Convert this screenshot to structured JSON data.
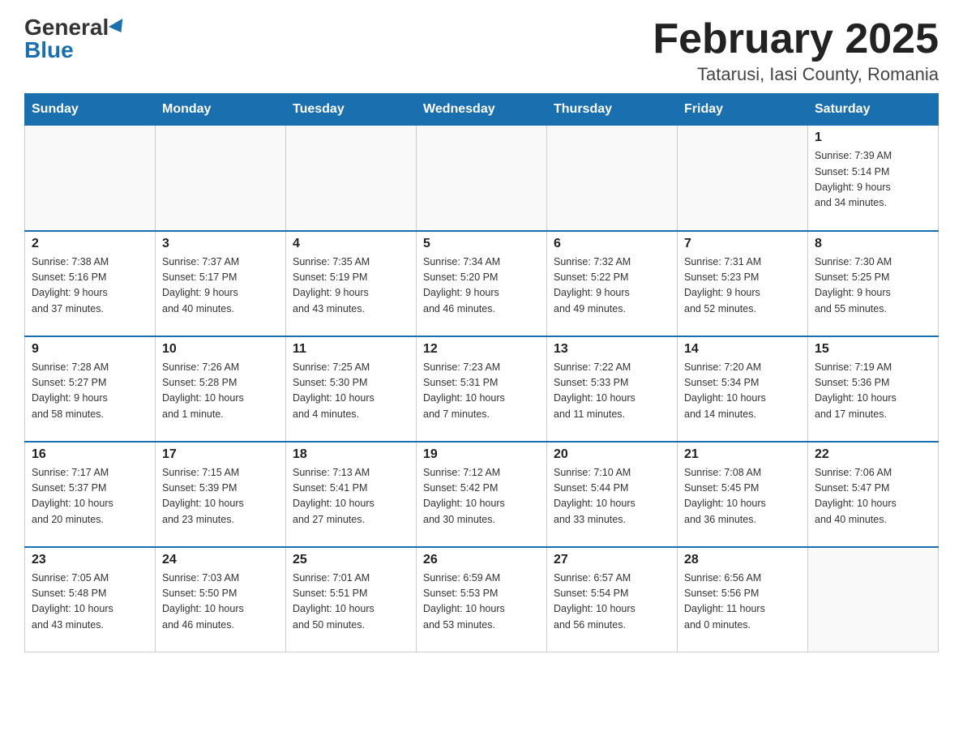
{
  "header": {
    "logo_general": "General",
    "logo_blue": "Blue",
    "month_title": "February 2025",
    "location": "Tatarusi, Iasi County, Romania"
  },
  "weekdays": [
    "Sunday",
    "Monday",
    "Tuesday",
    "Wednesday",
    "Thursday",
    "Friday",
    "Saturday"
  ],
  "weeks": [
    [
      {
        "day": "",
        "info": ""
      },
      {
        "day": "",
        "info": ""
      },
      {
        "day": "",
        "info": ""
      },
      {
        "day": "",
        "info": ""
      },
      {
        "day": "",
        "info": ""
      },
      {
        "day": "",
        "info": ""
      },
      {
        "day": "1",
        "info": "Sunrise: 7:39 AM\nSunset: 5:14 PM\nDaylight: 9 hours\nand 34 minutes."
      }
    ],
    [
      {
        "day": "2",
        "info": "Sunrise: 7:38 AM\nSunset: 5:16 PM\nDaylight: 9 hours\nand 37 minutes."
      },
      {
        "day": "3",
        "info": "Sunrise: 7:37 AM\nSunset: 5:17 PM\nDaylight: 9 hours\nand 40 minutes."
      },
      {
        "day": "4",
        "info": "Sunrise: 7:35 AM\nSunset: 5:19 PM\nDaylight: 9 hours\nand 43 minutes."
      },
      {
        "day": "5",
        "info": "Sunrise: 7:34 AM\nSunset: 5:20 PM\nDaylight: 9 hours\nand 46 minutes."
      },
      {
        "day": "6",
        "info": "Sunrise: 7:32 AM\nSunset: 5:22 PM\nDaylight: 9 hours\nand 49 minutes."
      },
      {
        "day": "7",
        "info": "Sunrise: 7:31 AM\nSunset: 5:23 PM\nDaylight: 9 hours\nand 52 minutes."
      },
      {
        "day": "8",
        "info": "Sunrise: 7:30 AM\nSunset: 5:25 PM\nDaylight: 9 hours\nand 55 minutes."
      }
    ],
    [
      {
        "day": "9",
        "info": "Sunrise: 7:28 AM\nSunset: 5:27 PM\nDaylight: 9 hours\nand 58 minutes."
      },
      {
        "day": "10",
        "info": "Sunrise: 7:26 AM\nSunset: 5:28 PM\nDaylight: 10 hours\nand 1 minute."
      },
      {
        "day": "11",
        "info": "Sunrise: 7:25 AM\nSunset: 5:30 PM\nDaylight: 10 hours\nand 4 minutes."
      },
      {
        "day": "12",
        "info": "Sunrise: 7:23 AM\nSunset: 5:31 PM\nDaylight: 10 hours\nand 7 minutes."
      },
      {
        "day": "13",
        "info": "Sunrise: 7:22 AM\nSunset: 5:33 PM\nDaylight: 10 hours\nand 11 minutes."
      },
      {
        "day": "14",
        "info": "Sunrise: 7:20 AM\nSunset: 5:34 PM\nDaylight: 10 hours\nand 14 minutes."
      },
      {
        "day": "15",
        "info": "Sunrise: 7:19 AM\nSunset: 5:36 PM\nDaylight: 10 hours\nand 17 minutes."
      }
    ],
    [
      {
        "day": "16",
        "info": "Sunrise: 7:17 AM\nSunset: 5:37 PM\nDaylight: 10 hours\nand 20 minutes."
      },
      {
        "day": "17",
        "info": "Sunrise: 7:15 AM\nSunset: 5:39 PM\nDaylight: 10 hours\nand 23 minutes."
      },
      {
        "day": "18",
        "info": "Sunrise: 7:13 AM\nSunset: 5:41 PM\nDaylight: 10 hours\nand 27 minutes."
      },
      {
        "day": "19",
        "info": "Sunrise: 7:12 AM\nSunset: 5:42 PM\nDaylight: 10 hours\nand 30 minutes."
      },
      {
        "day": "20",
        "info": "Sunrise: 7:10 AM\nSunset: 5:44 PM\nDaylight: 10 hours\nand 33 minutes."
      },
      {
        "day": "21",
        "info": "Sunrise: 7:08 AM\nSunset: 5:45 PM\nDaylight: 10 hours\nand 36 minutes."
      },
      {
        "day": "22",
        "info": "Sunrise: 7:06 AM\nSunset: 5:47 PM\nDaylight: 10 hours\nand 40 minutes."
      }
    ],
    [
      {
        "day": "23",
        "info": "Sunrise: 7:05 AM\nSunset: 5:48 PM\nDaylight: 10 hours\nand 43 minutes."
      },
      {
        "day": "24",
        "info": "Sunrise: 7:03 AM\nSunset: 5:50 PM\nDaylight: 10 hours\nand 46 minutes."
      },
      {
        "day": "25",
        "info": "Sunrise: 7:01 AM\nSunset: 5:51 PM\nDaylight: 10 hours\nand 50 minutes."
      },
      {
        "day": "26",
        "info": "Sunrise: 6:59 AM\nSunset: 5:53 PM\nDaylight: 10 hours\nand 53 minutes."
      },
      {
        "day": "27",
        "info": "Sunrise: 6:57 AM\nSunset: 5:54 PM\nDaylight: 10 hours\nand 56 minutes."
      },
      {
        "day": "28",
        "info": "Sunrise: 6:56 AM\nSunset: 5:56 PM\nDaylight: 11 hours\nand 0 minutes."
      },
      {
        "day": "",
        "info": ""
      }
    ]
  ]
}
